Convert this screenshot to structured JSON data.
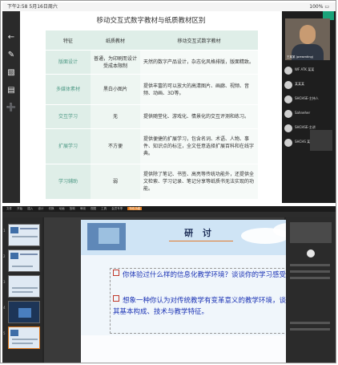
{
  "top_panel": {
    "status_left": "下午2:58   5月16日周六",
    "status_right": "100% ▭",
    "slide_title": "移动交互式数字教材与纸质教材区别",
    "table": {
      "headers": [
        "特征",
        "纸质教材",
        "移动交互式数字教材"
      ],
      "rows": [
        {
          "feature": "版面设计",
          "paper": "普通，为印刷而设计受成本限制",
          "mobile": "天然的数字产品设计，杂志化风格排版，版面精致。"
        },
        {
          "feature": "多媒体素材",
          "paper": "黑白小图片",
          "mobile": "提供丰富的可以放大的高清图片、画廊、视频、音频、动画、3D等。"
        },
        {
          "feature": "交互学习",
          "paper": "无",
          "mobile": "提供随堂化、游戏化、情景化的交互评测和练习。"
        },
        {
          "feature": "扩展学习",
          "paper": "不方便",
          "mobile": "提供便捷的扩展学习，包含名词、术语、人物、事件、知识点的标注，全文任意选择扩展百科和在线字典。"
        },
        {
          "feature": "学习辅助",
          "paper": "弱",
          "mobile": "提供除了笔记、书签、高亮等传统功能外，还提供全文检索、学习记录、笔记分享等纸质书无法实现的功能。"
        }
      ]
    },
    "tools": [
      "back-icon",
      "pen-icon",
      "eraser-icon",
      "comment-icon",
      "add-icon"
    ],
    "video_caption": "王某某 (presenting)",
    "participants": [
      "WF ATK 某某",
      "某某某",
      "SHCHSE-主持人",
      "Sahneher",
      "SHCHSE-主讲",
      "SHCHS 某某"
    ]
  },
  "bottom_panel": {
    "menu": [
      "文件",
      "开始",
      "插入",
      "设计",
      "切换",
      "动画",
      "放映",
      "审阅",
      "视图",
      "工具",
      "会员专享",
      "特色功能"
    ],
    "highlighted_menu": "特色功能",
    "thumb_numbers": [
      "1",
      "2",
      "3",
      "4",
      "5"
    ],
    "slide_title": "研 讨",
    "questions": [
      "你体验过什么样的信息化教学环境？谈谈你的学习感受。",
      "想象一种你认为对传统教学有变革意义的教学环境，谈谈其基本构成、技术与教学特征。"
    ]
  }
}
